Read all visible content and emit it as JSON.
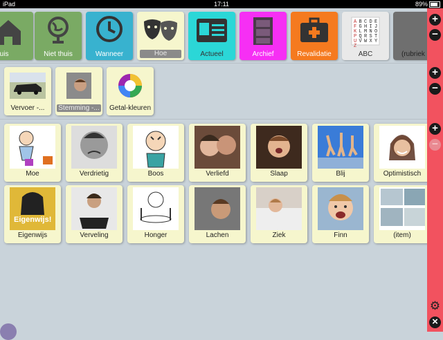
{
  "status": {
    "device": "iPad",
    "time": "17:11",
    "battery": "89%"
  },
  "categories": [
    {
      "label": "Thuis",
      "color": "#7aaa64",
      "icon": "house-icon"
    },
    {
      "label": "Niet thuis",
      "color": "#7aaa64",
      "icon": "globe-icon"
    },
    {
      "label": "Wanneer",
      "color": "#38b2cf",
      "icon": "clock-icon"
    },
    {
      "label": "Hoe",
      "color": "#f6f6cd",
      "icon": "theater-masks-icon"
    },
    {
      "label": "Actueel",
      "color": "#2bd7d7",
      "icon": "id-card-icon"
    },
    {
      "label": "Archief",
      "color": "#f62ff4",
      "icon": "file-cabinet-icon"
    },
    {
      "label": "Revalidatie",
      "color": "#f57a1f",
      "icon": "medical-kit-icon"
    },
    {
      "label": "ABC",
      "color": "#e9e9e9",
      "icon": "alphabet-chart-icon"
    },
    {
      "label": "(rubriek",
      "color": "#6f6f6f",
      "icon": ""
    }
  ],
  "subcategories": [
    {
      "label": "Vervoer -..."
    },
    {
      "label": "Stemming -..."
    },
    {
      "label": "Getal-kleuren"
    }
  ],
  "abc_letters": "ABCDEFGHIJKLMNOPQRSTUVWXYZ",
  "items_row1": [
    {
      "label": "Moe"
    },
    {
      "label": "Verdrietig"
    },
    {
      "label": "Boos"
    },
    {
      "label": "Verliefd"
    },
    {
      "label": "Slaap"
    },
    {
      "label": "Blij"
    },
    {
      "label": "Optimistisch"
    }
  ],
  "items_row2": [
    {
      "label": "Eigenwijs"
    },
    {
      "label": "Verveling"
    },
    {
      "label": "Honger"
    },
    {
      "label": "Lachen"
    },
    {
      "label": "Ziek"
    },
    {
      "label": "Finn"
    },
    {
      "label": "(item)"
    }
  ],
  "poster_text": "Eigenwijs!",
  "sidebar": {
    "plus": "+",
    "minus": "−",
    "close": "×",
    "gear": "⚙"
  }
}
